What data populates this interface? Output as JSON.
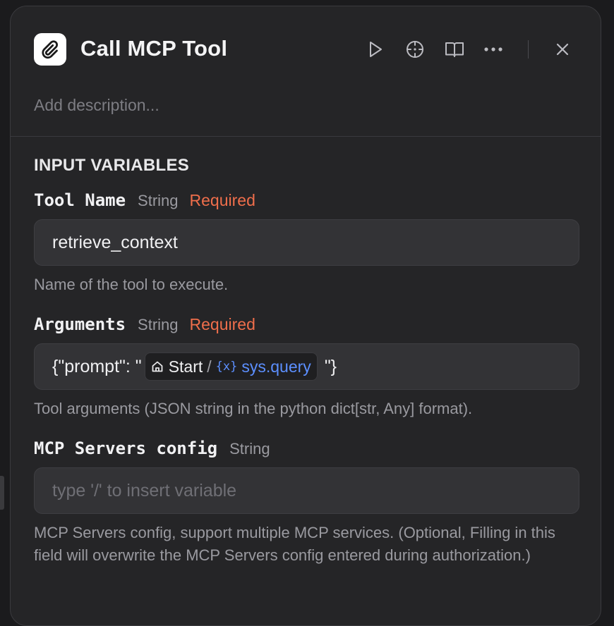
{
  "node": {
    "title": "Call MCP Tool",
    "description_placeholder": "Add description..."
  },
  "toolbar": {
    "run_icon": "play-icon",
    "locate_icon": "crosshair-icon",
    "help_icon": "book-icon",
    "more_icon": "more-icon",
    "close_icon": "close-icon"
  },
  "section": {
    "title": "INPUT VARIABLES"
  },
  "fields": {
    "tool_name": {
      "label": "Tool Name",
      "type": "String",
      "required": "Required",
      "value": "retrieve_context",
      "help": "Name of the tool to execute."
    },
    "arguments": {
      "label": "Arguments",
      "type": "String",
      "required": "Required",
      "value_prefix": "{\"prompt\": \"",
      "value_suffix": "\"}",
      "variable": {
        "node": "Start",
        "separator": "/",
        "icon_text": "{x}",
        "name": "sys.query"
      },
      "help": "Tool arguments (JSON string in the python dict[str, Any] format)."
    },
    "mcp_config": {
      "label": "MCP Servers config",
      "type": "String",
      "placeholder": "type '/' to insert variable",
      "help": "MCP Servers config, support multiple MCP services. (Optional, Filling in this field will overwrite the MCP Servers config entered during authorization.)"
    }
  },
  "colors": {
    "required": "#ef6e4b",
    "variable": "#5c8fff",
    "panel_bg": "#252527"
  }
}
